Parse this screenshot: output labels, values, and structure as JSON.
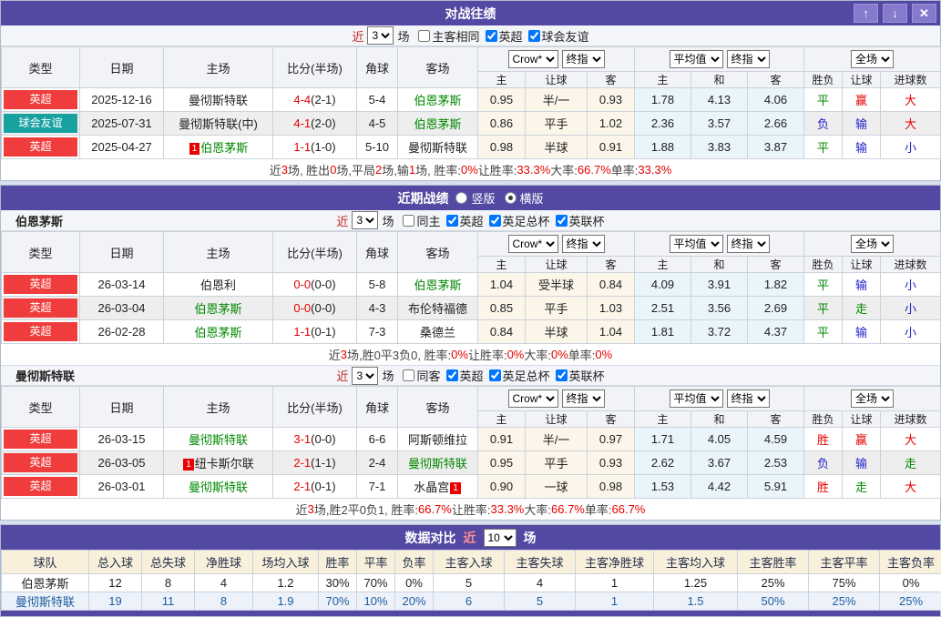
{
  "labels": {
    "near": "近",
    "games": "场"
  },
  "window_buttons": {
    "up": "↑",
    "down": "↓",
    "close": "✕"
  },
  "selects": {
    "company": "Crow*",
    "final": "终指",
    "average": "平均值",
    "scope": "全场"
  },
  "cols": {
    "type": "类型",
    "date": "日期",
    "home": "主场",
    "score": "比分(半场)",
    "corner": "角球",
    "away": "客场",
    "h": "主",
    "handicap": "让球",
    "a": "客",
    "draw": "和",
    "result": "胜负",
    "goals": "进球数"
  },
  "h2h": {
    "title": "对战往绩",
    "controls": {
      "near": "3",
      "checks": [
        {
          "label": "主客相同",
          "checked": false
        },
        {
          "label": "英超",
          "checked": true
        },
        {
          "label": "球会友谊",
          "checked": true
        }
      ]
    },
    "rows": [
      {
        "comp": {
          "t": "英超",
          "cls": "red"
        },
        "date": "2025-12-16",
        "home": {
          "t": "曼彻斯特联"
        },
        "ft": "4-4",
        "ht": "(2-1)",
        "corner": "5-4",
        "away": {
          "t": "伯恩茅斯",
          "c": "g"
        },
        "odds": [
          "0.95",
          "半/一",
          "0.93"
        ],
        "avg": [
          "1.78",
          "4.13",
          "4.06"
        ],
        "res": [
          {
            "t": "平",
            "c": "g"
          },
          {
            "t": "赢",
            "c": "r"
          },
          {
            "t": "大",
            "c": "r"
          }
        ]
      },
      {
        "comp": {
          "t": "球会友谊",
          "cls": "teal"
        },
        "date": "2025-07-31",
        "home": {
          "t": "曼彻斯特联(中)"
        },
        "ft": "4-1",
        "ht": "(2-0)",
        "corner": "4-5",
        "away": {
          "t": "伯恩茅斯",
          "c": "g"
        },
        "odds": [
          "0.86",
          "平手",
          "1.02"
        ],
        "avg": [
          "2.36",
          "3.57",
          "2.66"
        ],
        "res": [
          {
            "t": "负",
            "c": "b"
          },
          {
            "t": "输",
            "c": "b"
          },
          {
            "t": "大",
            "c": "r"
          }
        ]
      },
      {
        "comp": {
          "t": "英超",
          "cls": "red"
        },
        "date": "2025-04-27",
        "home": {
          "t": "伯恩茅斯",
          "c": "g",
          "b1": "1"
        },
        "ft": "1-1",
        "ht": "(1-0)",
        "corner": "5-10",
        "away": {
          "t": "曼彻斯特联"
        },
        "odds": [
          "0.98",
          "半球",
          "0.91"
        ],
        "avg": [
          "1.88",
          "3.83",
          "3.87"
        ],
        "res": [
          {
            "t": "平",
            "c": "g"
          },
          {
            "t": "输",
            "c": "b"
          },
          {
            "t": "小",
            "c": "b"
          }
        ]
      }
    ],
    "summary": [
      {
        "t": "近 "
      },
      {
        "t": "3",
        "c": "r"
      },
      {
        "t": " 场, 胜出 "
      },
      {
        "t": "0",
        "c": "r"
      },
      {
        "t": " 场,平局 "
      },
      {
        "t": "2",
        "c": "r"
      },
      {
        "t": " 场,输 "
      },
      {
        "t": "1",
        "c": "r"
      },
      {
        "t": " 场, 胜率: "
      },
      {
        "t": "0%",
        "c": "r"
      },
      {
        "t": " 让胜率: "
      },
      {
        "t": "33.3%",
        "c": "r"
      },
      {
        "t": " 大率: "
      },
      {
        "t": "66.7%",
        "c": "r"
      },
      {
        "t": " 单率: "
      },
      {
        "t": "33.3%",
        "c": "r"
      }
    ]
  },
  "recent": {
    "title": "近期战绩",
    "radios": [
      {
        "label": "竖版",
        "checked": false
      },
      {
        "label": "横版",
        "checked": true
      }
    ],
    "team1": {
      "name": "伯恩茅斯",
      "controls": {
        "near": "3",
        "checks": [
          {
            "label": "同主",
            "checked": false
          },
          {
            "label": "英超",
            "checked": true
          },
          {
            "label": "英足总杯",
            "checked": true
          },
          {
            "label": "英联杯",
            "checked": true
          }
        ]
      },
      "rows": [
        {
          "comp": {
            "t": "英超",
            "cls": "red"
          },
          "date": "26-03-14",
          "home": {
            "t": "伯恩利"
          },
          "ft": "0-0",
          "ht": "(0-0)",
          "corner": "5-8",
          "away": {
            "t": "伯恩茅斯",
            "c": "g"
          },
          "odds": [
            "1.04",
            "受半球",
            "0.84"
          ],
          "avg": [
            "4.09",
            "3.91",
            "1.82"
          ],
          "res": [
            {
              "t": "平",
              "c": "g"
            },
            {
              "t": "输",
              "c": "b"
            },
            {
              "t": "小",
              "c": "b"
            }
          ]
        },
        {
          "comp": {
            "t": "英超",
            "cls": "red"
          },
          "date": "26-03-04",
          "home": {
            "t": "伯恩茅斯",
            "c": "g"
          },
          "ft": "0-0",
          "ht": "(0-0)",
          "corner": "4-3",
          "away": {
            "t": "布伦特福德"
          },
          "odds": [
            "0.85",
            "平手",
            "1.03"
          ],
          "avg": [
            "2.51",
            "3.56",
            "2.69"
          ],
          "res": [
            {
              "t": "平",
              "c": "g"
            },
            {
              "t": "走",
              "c": "g"
            },
            {
              "t": "小",
              "c": "b"
            }
          ]
        },
        {
          "comp": {
            "t": "英超",
            "cls": "red"
          },
          "date": "26-02-28",
          "home": {
            "t": "伯恩茅斯",
            "c": "g"
          },
          "ft": "1-1",
          "ht": "(0-1)",
          "corner": "7-3",
          "away": {
            "t": "桑德兰"
          },
          "odds": [
            "0.84",
            "半球",
            "1.04"
          ],
          "avg": [
            "1.81",
            "3.72",
            "4.37"
          ],
          "res": [
            {
              "t": "平",
              "c": "g"
            },
            {
              "t": "输",
              "c": "b"
            },
            {
              "t": "小",
              "c": "b"
            }
          ]
        }
      ],
      "summary": [
        {
          "t": "近"
        },
        {
          "t": "3",
          "c": "r"
        },
        {
          "t": "场,胜0平3负0, 胜率:"
        },
        {
          "t": "0%",
          "c": "r"
        },
        {
          "t": " 让胜率:"
        },
        {
          "t": "0%",
          "c": "r"
        },
        {
          "t": " 大率:"
        },
        {
          "t": "0%",
          "c": "r"
        },
        {
          "t": " 单率:"
        },
        {
          "t": "0%",
          "c": "r"
        }
      ]
    },
    "team2": {
      "name": "曼彻斯特联",
      "controls": {
        "near": "3",
        "checks": [
          {
            "label": "同客",
            "checked": false
          },
          {
            "label": "英超",
            "checked": true
          },
          {
            "label": "英足总杯",
            "checked": true
          },
          {
            "label": "英联杯",
            "checked": true
          }
        ]
      },
      "rows": [
        {
          "comp": {
            "t": "英超",
            "cls": "red"
          },
          "date": "26-03-15",
          "home": {
            "t": "曼彻斯特联",
            "c": "g"
          },
          "ft": "3-1",
          "ht": "(0-0)",
          "corner": "6-6",
          "away": {
            "t": "阿斯顿维拉"
          },
          "odds": [
            "0.91",
            "半/一",
            "0.97"
          ],
          "avg": [
            "1.71",
            "4.05",
            "4.59"
          ],
          "res": [
            {
              "t": "胜",
              "c": "r"
            },
            {
              "t": "赢",
              "c": "r"
            },
            {
              "t": "大",
              "c": "r"
            }
          ]
        },
        {
          "comp": {
            "t": "英超",
            "cls": "red"
          },
          "date": "26-03-05",
          "home": {
            "t": "纽卡斯尔联",
            "b1": "1"
          },
          "ft": "2-1",
          "ht": "(1-1)",
          "corner": "2-4",
          "away": {
            "t": "曼彻斯特联",
            "c": "g"
          },
          "odds": [
            "0.95",
            "平手",
            "0.93"
          ],
          "avg": [
            "2.62",
            "3.67",
            "2.53"
          ],
          "res": [
            {
              "t": "负",
              "c": "b"
            },
            {
              "t": "输",
              "c": "b"
            },
            {
              "t": "走",
              "c": "g"
            }
          ]
        },
        {
          "comp": {
            "t": "英超",
            "cls": "red"
          },
          "date": "26-03-01",
          "home": {
            "t": "曼彻斯特联",
            "c": "g"
          },
          "ft": "2-1",
          "ht": "(0-1)",
          "corner": "7-1",
          "away": {
            "t": "水晶宫",
            "b2": "1"
          },
          "odds": [
            "0.90",
            "一球",
            "0.98"
          ],
          "avg": [
            "1.53",
            "4.42",
            "5.91"
          ],
          "res": [
            {
              "t": "胜",
              "c": "r"
            },
            {
              "t": "走",
              "c": "g"
            },
            {
              "t": "大",
              "c": "r"
            }
          ]
        }
      ],
      "summary": [
        {
          "t": "近"
        },
        {
          "t": "3",
          "c": "r"
        },
        {
          "t": "场,胜2平0负1, 胜率:"
        },
        {
          "t": "66.7%",
          "c": "r"
        },
        {
          "t": " 让胜率:"
        },
        {
          "t": "33.3%",
          "c": "r"
        },
        {
          "t": " 大率:"
        },
        {
          "t": "66.7%",
          "c": "r"
        },
        {
          "t": " 单率:"
        },
        {
          "t": "66.7%",
          "c": "r"
        }
      ]
    }
  },
  "compare": {
    "title": "数据对比",
    "near": "10",
    "headers": [
      "球队",
      "总入球",
      "总失球",
      "净胜球",
      "场均入球",
      "胜率",
      "平率",
      "负率",
      "主客入球",
      "主客失球",
      "主客净胜球",
      "主客均入球",
      "主客胜率",
      "主客平率",
      "主客负率"
    ],
    "rows": [
      {
        "name": "伯恩茅斯",
        "cls": "",
        "vals": [
          "12",
          "8",
          "4",
          "1.2",
          "30%",
          "70%",
          "0%",
          "5",
          "4",
          "1",
          "1.25",
          "25%",
          "75%",
          "0%"
        ]
      },
      {
        "name": "曼彻斯特联",
        "cls": "blue",
        "vals": [
          "19",
          "11",
          "8",
          "1.9",
          "70%",
          "10%",
          "20%",
          "6",
          "5",
          "1",
          "1.5",
          "50%",
          "25%",
          "25%"
        ]
      }
    ]
  },
  "colors": {
    "bar_purple": "#5348a2",
    "league_red": "#f03c3c",
    "friendly_teal": "#17a2a0",
    "team_green": "#008800",
    "loss_blue": "#2222cc",
    "win_red": "#e60000",
    "odds_bg": "#fcf5e9",
    "avg_bg": "#eaf4fb",
    "compare_header_bg": "#f9f0dc"
  }
}
